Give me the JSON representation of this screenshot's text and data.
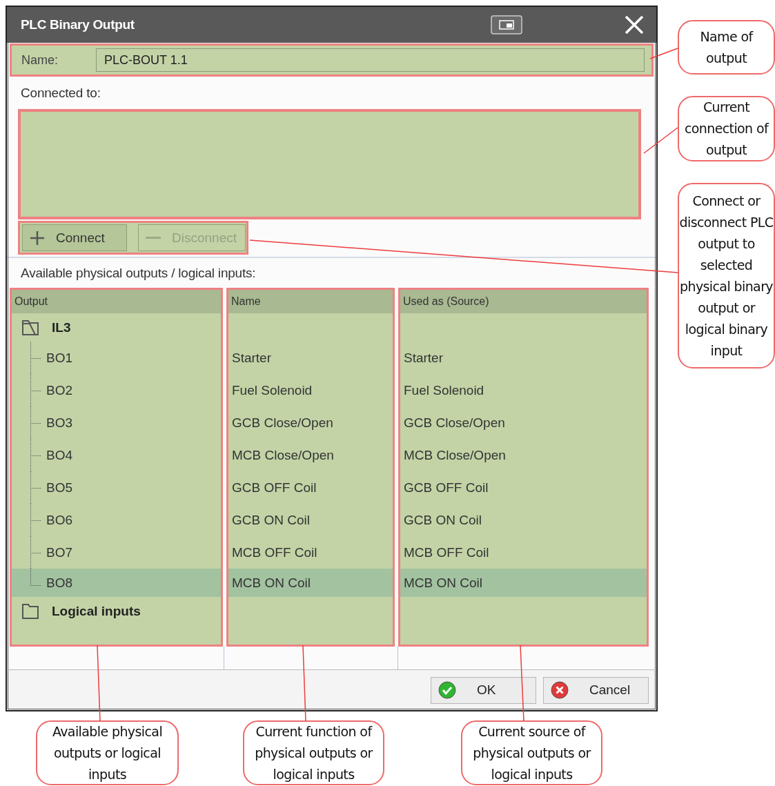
{
  "dialog": {
    "title": "PLC Binary Output",
    "name_field": {
      "label": "Name:",
      "value": "PLC-BOUT 1.1"
    },
    "connected_label": "Connected to:",
    "actions": [
      {
        "kind": "connect",
        "label": "Connect",
        "disabled": false
      },
      {
        "kind": "disconnect",
        "label": "Disconnect",
        "disabled": true
      }
    ],
    "available_label": "Available physical outputs / logical inputs:",
    "table": {
      "columns": [
        "Output",
        "Name",
        "Used as (Source)"
      ],
      "groups": [
        {
          "label": "IL3",
          "expanded": true,
          "children": [
            {
              "output": "BO1",
              "name": "Starter",
              "source": "Starter",
              "selected": false
            },
            {
              "output": "BO2",
              "name": "Fuel Solenoid",
              "source": "Fuel Solenoid",
              "selected": false
            },
            {
              "output": "BO3",
              "name": "GCB Close/Open",
              "source": "GCB Close/Open",
              "selected": false
            },
            {
              "output": "BO4",
              "name": "MCB Close/Open",
              "source": "MCB Close/Open",
              "selected": false
            },
            {
              "output": "BO5",
              "name": "GCB OFF Coil",
              "source": "GCB OFF Coil",
              "selected": false
            },
            {
              "output": "BO6",
              "name": "GCB ON Coil",
              "source": "GCB ON Coil",
              "selected": false
            },
            {
              "output": "BO7",
              "name": "MCB OFF Coil",
              "source": "MCB OFF Coil",
              "selected": false
            },
            {
              "output": "BO8",
              "name": "MCB ON Coil",
              "source": "MCB ON Coil",
              "selected": true
            }
          ]
        },
        {
          "label": "Logical inputs",
          "expanded": false
        }
      ]
    },
    "footer_buttons": [
      {
        "kind": "ok",
        "label": "OK"
      },
      {
        "kind": "cancel",
        "label": "Cancel"
      }
    ]
  },
  "side_notes": [
    "Name of output",
    "Current connection of output",
    "Connect or disconnect PLC output to selected physical binary output or logical binary input"
  ],
  "bottom_notes": [
    "Available physical outputs or logical inputs",
    "Current function of physical outputs or logical inputs",
    "Current source of physical outputs or logical inputs"
  ]
}
